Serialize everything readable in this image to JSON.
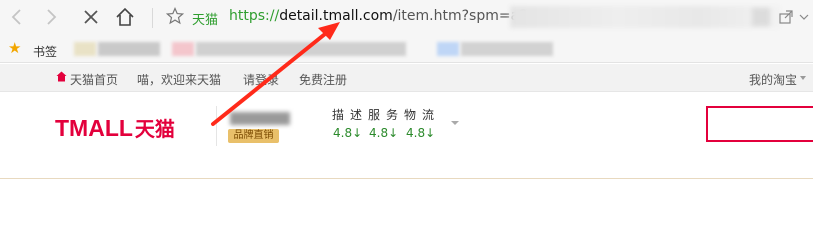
{
  "browser": {
    "security_label": "天猫",
    "url": {
      "protocol": "https://",
      "host": "detail.tmall.com",
      "path": "/item.htm?spm=a2"
    }
  },
  "bookmarks": {
    "label": "书签",
    "blurred_colors": [
      "#e9e2c6",
      "#c9c9c9",
      "#f4c6cc",
      "#d0d0d0",
      "#bfd6f6",
      "#d2d2d2"
    ]
  },
  "site_nav": {
    "home": "天猫首页",
    "welcome": "喵，欢迎来天猫",
    "login": "请登录",
    "register": "免费注册",
    "my_taobao": "我的淘宝"
  },
  "header": {
    "logo_latin": "TMALL",
    "logo_cn": "天猫",
    "brand_badge": "品牌直销",
    "score_title": "描述服务物流",
    "scores": [
      "4.8↓",
      "4.8↓",
      "4.8↓"
    ]
  },
  "colors": {
    "brand": "#e3003c",
    "secure_green": "#2f9e2f",
    "score_green": "#2b8a2b",
    "annotation_arrow": "#ff2a1a"
  }
}
